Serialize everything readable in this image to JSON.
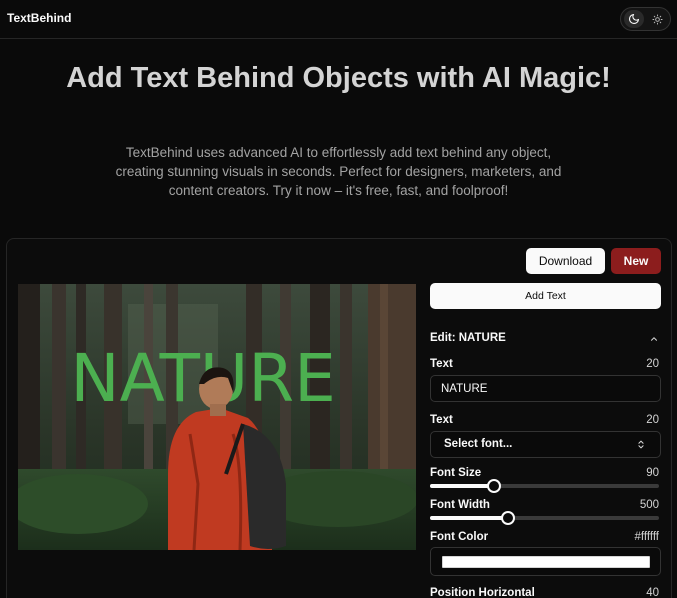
{
  "app": {
    "brand": "TextBehind"
  },
  "theme_toggle": {
    "options": [
      "moon-icon",
      "sun-icon"
    ],
    "selected": "dark"
  },
  "hero": {
    "title": "Add Text Behind Objects with AI Magic!",
    "subtitle": "TextBehind uses advanced AI to effortlessly add text behind any object, creating stunning visuals in seconds. Perfect for designers, marketers, and content creators. Try it now – it's free, fast, and foolproof!"
  },
  "toolbar": {
    "download_label": "Download",
    "new_label": "New"
  },
  "canvas": {
    "overlay_text": "NATURE",
    "overlay_color": "#4caf50"
  },
  "panel": {
    "add_text_label": "Add Text",
    "edit_title": "Edit: NATURE",
    "text": {
      "label": "Text",
      "count": "20",
      "value": "NATURE"
    },
    "font": {
      "label": "Text",
      "count": "20",
      "placeholder": "Select font..."
    },
    "font_size": {
      "label": "Font Size",
      "value": "90",
      "fraction": 0.28
    },
    "font_width": {
      "label": "Font Width",
      "value": "500",
      "fraction": 0.34
    },
    "font_color": {
      "label": "Font Color",
      "value": "#ffffff"
    },
    "position_horizontal": {
      "label": "Position Horizontal",
      "value": "40"
    }
  },
  "colors": {
    "background": "#0a0a0a",
    "new_button": "#8c1d1d",
    "text_primary": "#fafafa"
  }
}
